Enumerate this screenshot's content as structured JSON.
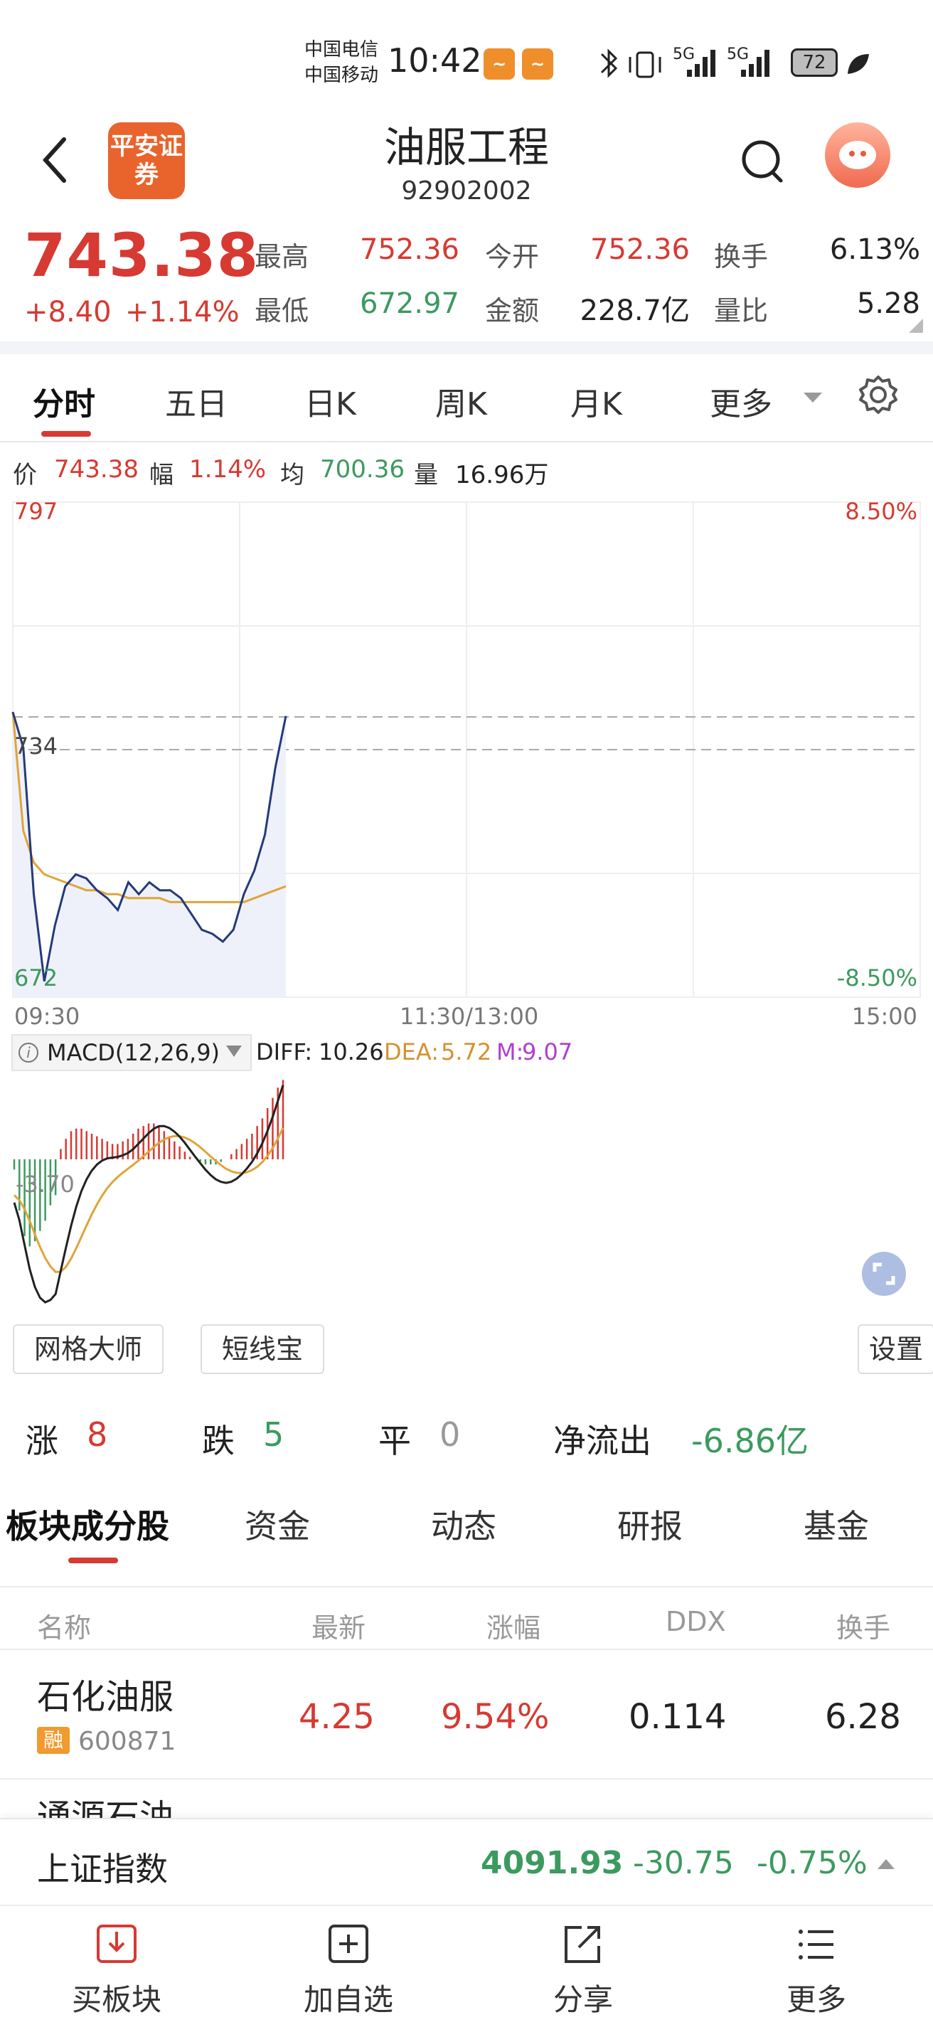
{
  "status_bar": {
    "carrier1": "中国电信",
    "carrier2": "中国移动",
    "time": "10:42",
    "net1": "5G",
    "net2": "5G",
    "battery": "72"
  },
  "header": {
    "logo_text": "平安证券",
    "title": "油服工程",
    "code": "92902002"
  },
  "quote": {
    "price": "743.38",
    "change": "+8.40",
    "change_pct": "+1.14%",
    "high_label": "最高",
    "high": "752.36",
    "open_label": "今开",
    "open": "752.36",
    "turnover_label": "换手",
    "turnover": "6.13%",
    "low_label": "最低",
    "low": "672.97",
    "amount_label": "金额",
    "amount": "228.7亿",
    "vol_ratio_label": "量比",
    "vol_ratio": "5.28"
  },
  "chart_tabs": [
    "分时",
    "五日",
    "日K",
    "周K",
    "月K",
    "更多"
  ],
  "info_line": {
    "price_label": "价",
    "price": "743.38",
    "range_label": "幅",
    "range": "1.14%",
    "avg_label": "均",
    "avg": "700.36",
    "vol_label": "量",
    "vol": "16.96万"
  },
  "chart_data": {
    "type": "line",
    "y_top": "797",
    "y_mid": "734",
    "y_bottom": "672",
    "pct_top": "8.50%",
    "pct_bottom": "-8.50%",
    "x_labels": [
      "09:30",
      "11:30/13:00",
      "15:00"
    ],
    "ylim": [
      672,
      797
    ],
    "series": [
      {
        "values": [
          744,
          735,
          698,
          676,
          690,
          700,
          703,
          702,
          699,
          697,
          694,
          701,
          698,
          701,
          699,
          699,
          697,
          693,
          689,
          688,
          686,
          689,
          698,
          704,
          713,
          730,
          743
        ]
      },
      {
        "values": [
          744,
          714,
          706,
          703,
          702,
          701,
          700,
          699,
          699,
          698,
          698,
          697,
          697,
          697,
          697,
          696,
          696,
          696,
          696,
          696,
          696,
          696,
          696,
          697,
          698,
          699,
          700
        ]
      }
    ]
  },
  "macd": {
    "name": "MACD(12,26,9)",
    "diff_label": "DIFF:",
    "diff": "10.26",
    "dea_label": "DEA:",
    "dea": "5.72",
    "m_label": "M:",
    "m": "9.07",
    "axis_value": "-3.70",
    "hist": [
      -4,
      -20,
      -30,
      -34,
      -32,
      -28,
      -24,
      -18,
      -14,
      4,
      8,
      11,
      12,
      12,
      11,
      10,
      9,
      8,
      7,
      6,
      6,
      7,
      8,
      10,
      12,
      13,
      14,
      14,
      13,
      11,
      9,
      7,
      5,
      3,
      1,
      0,
      -1,
      -2,
      -2,
      -2,
      -1,
      0,
      2,
      4,
      6,
      8,
      10,
      13,
      16,
      20,
      24,
      28,
      31
    ]
  },
  "tools": {
    "grid": "网格大师",
    "short": "短线宝",
    "settings": "设置"
  },
  "stats": {
    "up_label": "涨",
    "up": "8",
    "down_label": "跌",
    "down": "5",
    "flat_label": "平",
    "flat": "0",
    "net_label": "净流出",
    "net": "-6.86亿"
  },
  "sector_tabs": [
    "板块成分股",
    "资金",
    "动态",
    "研报",
    "基金"
  ],
  "table": {
    "headers": [
      "名称",
      "最新",
      "涨幅",
      "DDX",
      "换手"
    ],
    "rows": [
      {
        "name": "石化油服",
        "badge": "融",
        "code": "600871",
        "price": "4.25",
        "change": "9.54%",
        "ddx": "0.114",
        "turnover": "6.28"
      }
    ],
    "partial_row_name": "通源石油"
  },
  "index_bar": {
    "name": "上证指数",
    "value": "4091.93",
    "change": "-30.75",
    "pct": "-0.75%"
  },
  "bottom_nav": [
    "买板块",
    "加自选",
    "分享",
    "更多"
  ],
  "colors": {
    "red": "#d63a32",
    "green": "#3c9a5f",
    "line": "#243a7a",
    "avg": "#e0a43a",
    "orange_brand": "#e9632c"
  }
}
